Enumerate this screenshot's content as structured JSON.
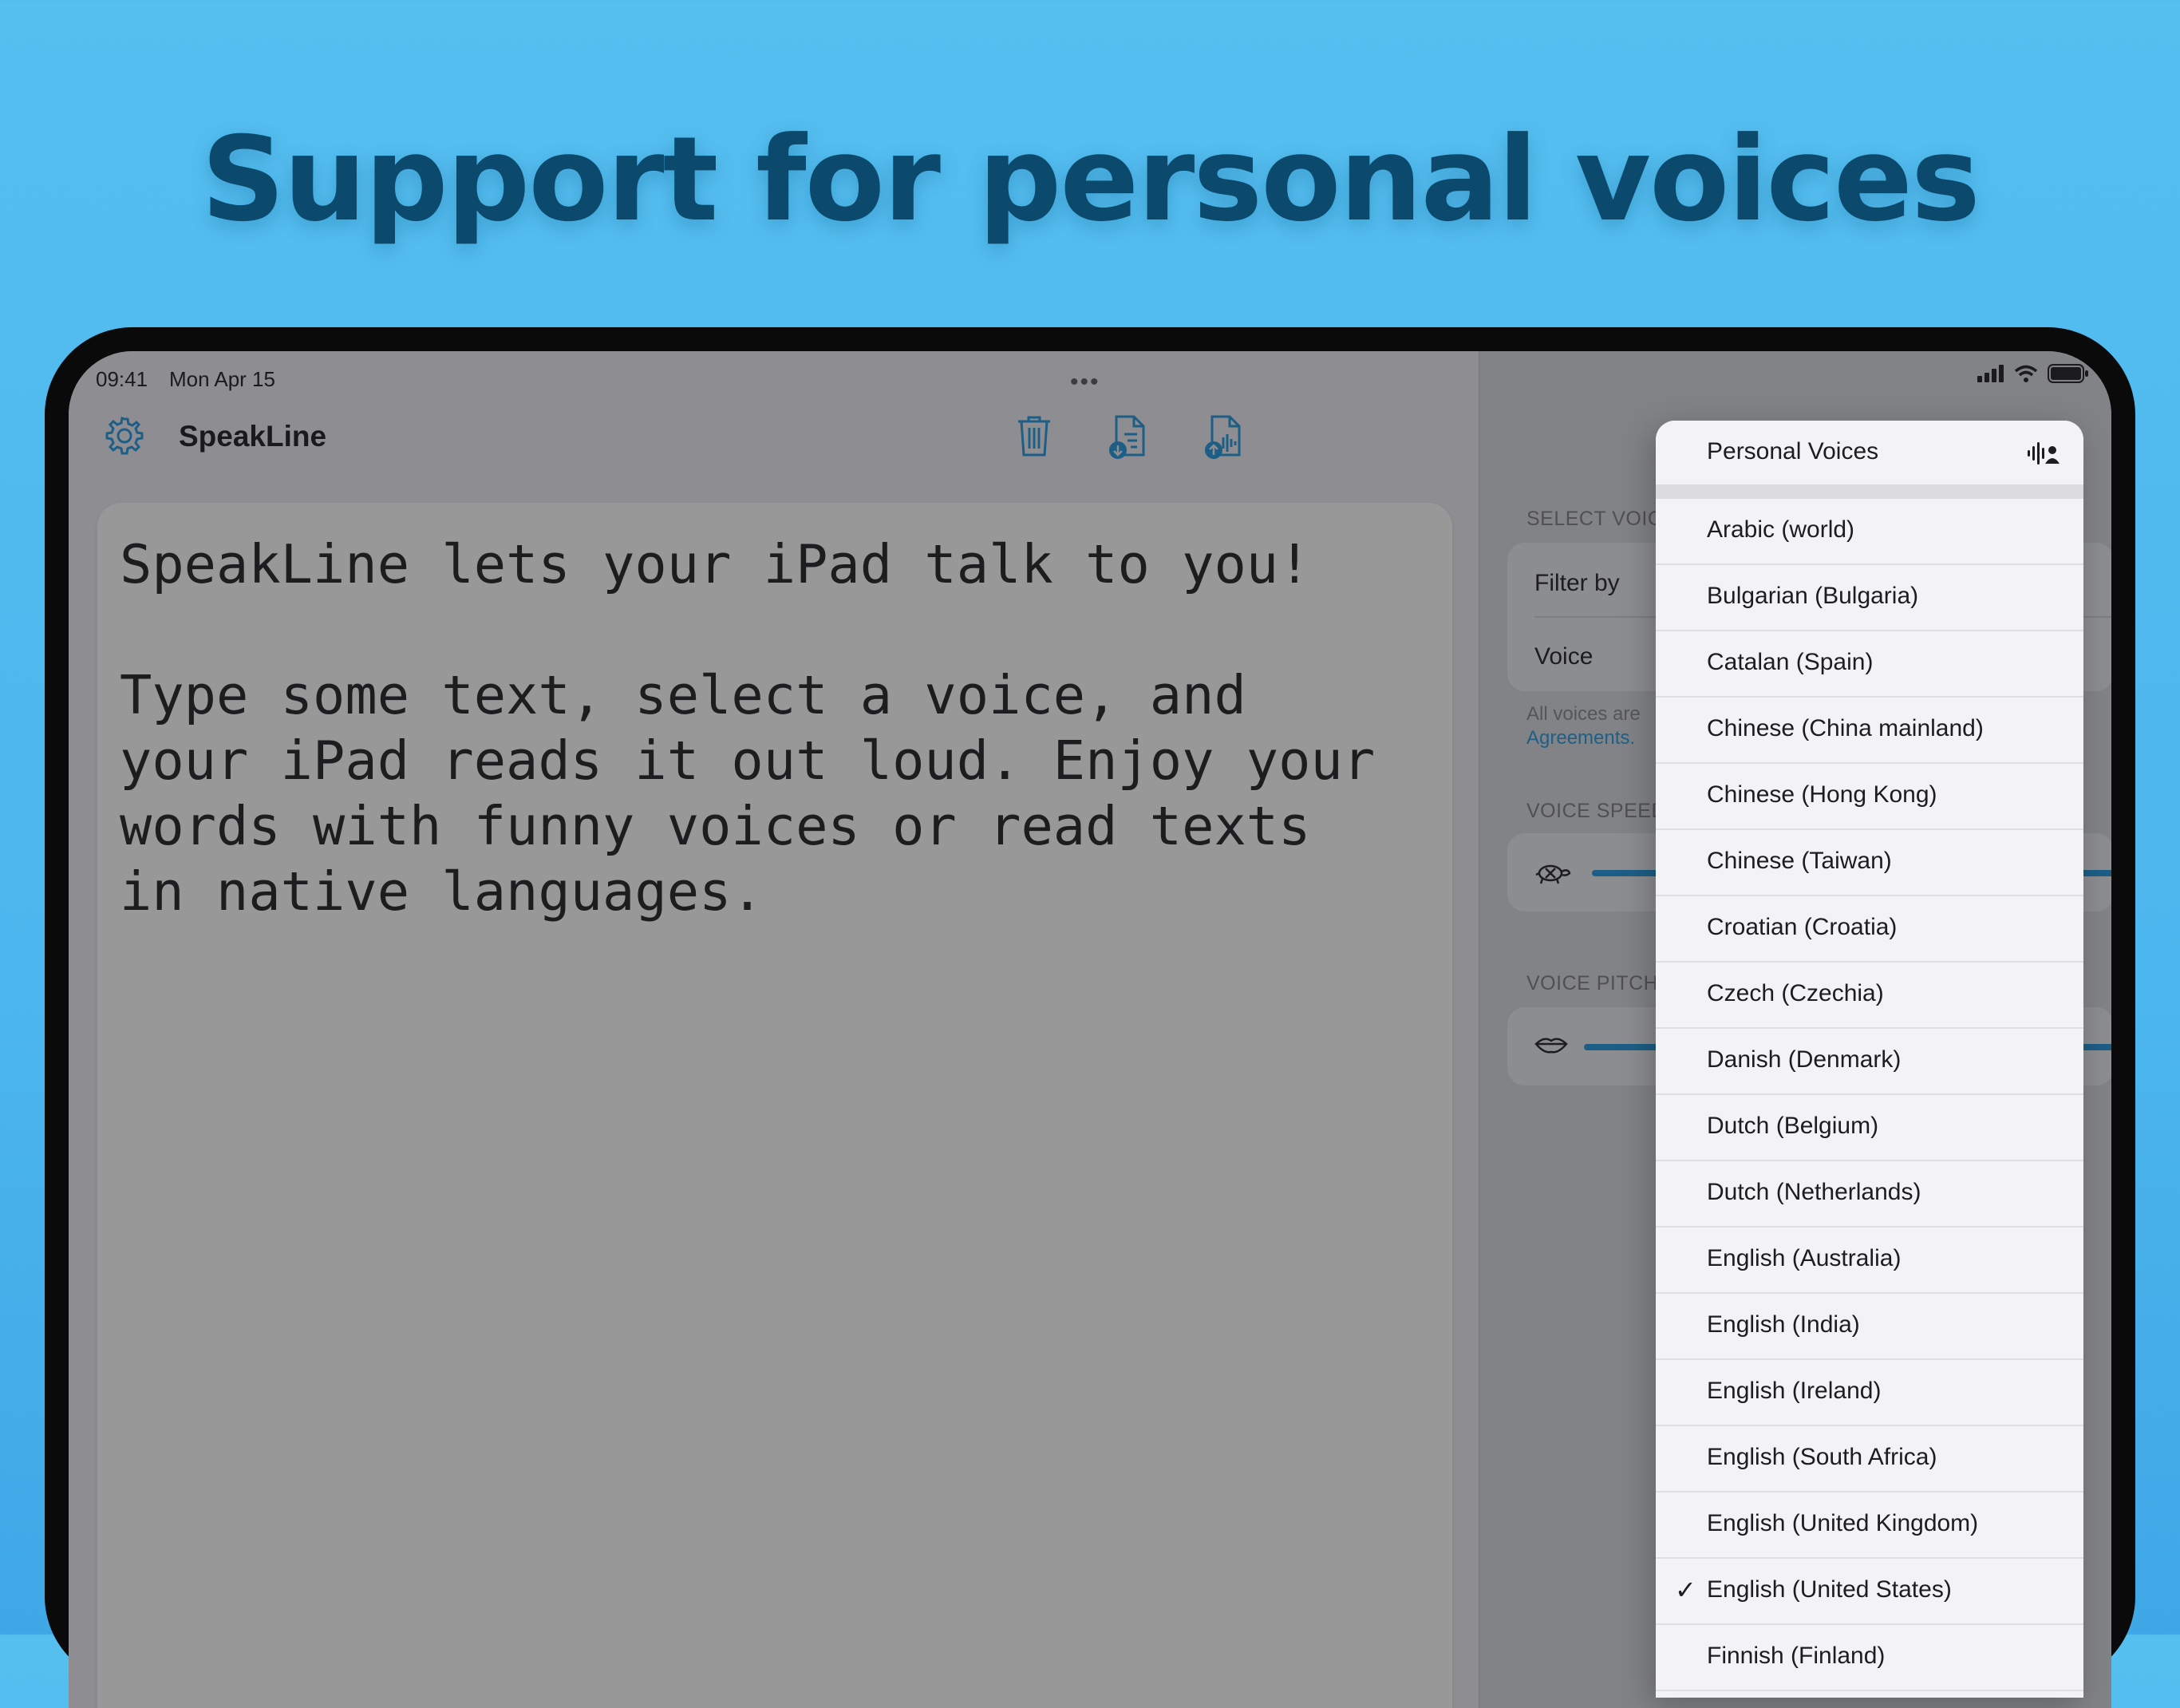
{
  "headline": "Support for personal voices",
  "status_bar": {
    "time": "09:41",
    "date": "Mon Apr 15",
    "multitask_dots": "•••"
  },
  "app": {
    "title": "SpeakLine"
  },
  "editor": {
    "text": "SpeakLine lets your iPad talk to you!\n\nType some text, select a voice, and\nyour iPad reads it out loud. Enjoy your\nwords with funny voices or read texts\nin native languages."
  },
  "sidebar": {
    "select_voice_label": "SELECT VOIC",
    "filter_by_label": "Filter by",
    "voice_label": "Voice",
    "footnote_text": "All voices are",
    "footnote_link": "Agreements.",
    "voice_speed_label": "VOICE SPEED",
    "voice_pitch_label": "VOICE PITCH"
  },
  "dropdown": {
    "header": "Personal Voices",
    "selected_check": "✓",
    "items": [
      "Arabic (world)",
      "Bulgarian (Bulgaria)",
      "Catalan (Spain)",
      "Chinese (China mainland)",
      "Chinese (Hong Kong)",
      "Chinese (Taiwan)",
      "Croatian (Croatia)",
      "Czech (Czechia)",
      "Danish (Denmark)",
      "Dutch (Belgium)",
      "Dutch (Netherlands)",
      "English (Australia)",
      "English (India)",
      "English (Ireland)",
      "English (South Africa)",
      "English (United Kingdom)",
      "English (United States)",
      "Finnish (Finland)"
    ],
    "selected_index": 16
  },
  "colors": {
    "accent": "#1d5e86",
    "headline": "#0b4a6c",
    "background": "#55bff0"
  }
}
